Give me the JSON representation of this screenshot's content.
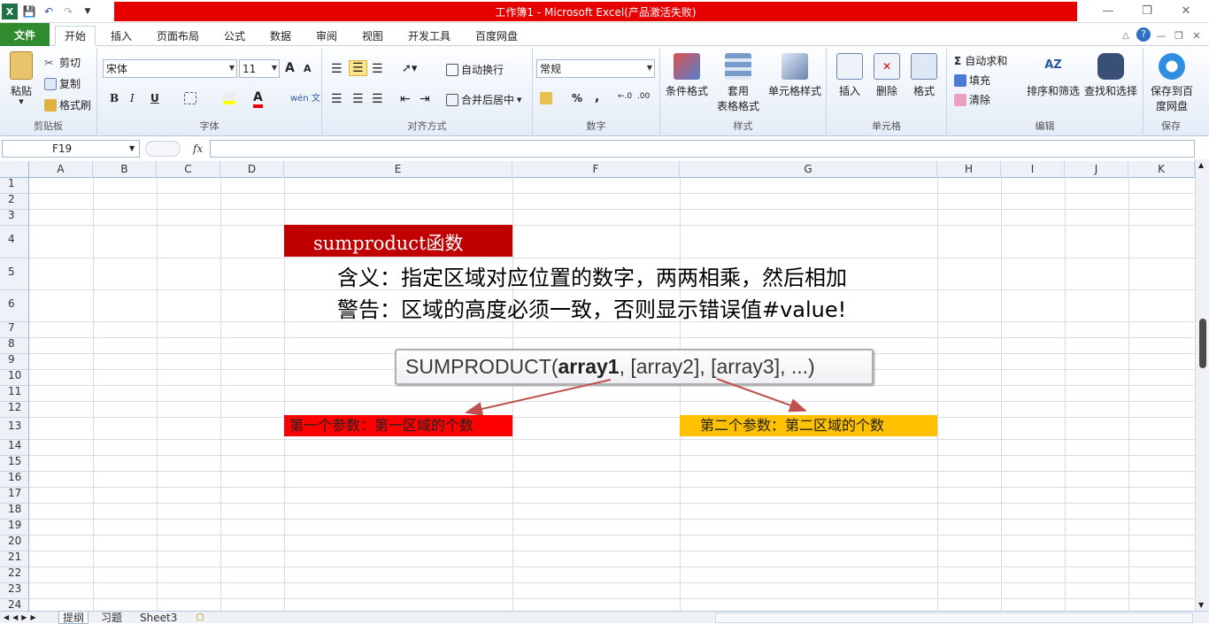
{
  "window": {
    "title": "工作簿1 - Microsoft Excel(产品激活失败)",
    "title_bg": "#e60000"
  },
  "tabs": [
    "文件",
    "开始",
    "插入",
    "页面布局",
    "公式",
    "数据",
    "审阅",
    "视图",
    "开发工具",
    "百度网盘"
  ],
  "ribbon": {
    "clipboard": {
      "label": "剪贴板",
      "paste": "粘贴",
      "cut": "剪切",
      "copy": "复制",
      "format_painter": "格式刷"
    },
    "font": {
      "label": "字体",
      "font_name": "宋体",
      "font_size": "11",
      "bold": "B",
      "italic": "I",
      "underline": "U",
      "grow": "A",
      "shrink": "A",
      "color_a": "A",
      "wen": "wén 文"
    },
    "alignment": {
      "label": "对齐方式",
      "wrap": "自动换行",
      "merge": "合并后居中"
    },
    "number": {
      "label": "数字",
      "format": "常规",
      "percent": "%",
      "comma": ","
    },
    "styles": {
      "label": "样式",
      "conditional": "条件格式",
      "table1": "套用",
      "table2": "表格格式",
      "cell_styles": "单元格样式"
    },
    "cells": {
      "label": "单元格",
      "insert": "插入",
      "delete": "删除",
      "format": "格式"
    },
    "editing": {
      "label": "编辑",
      "autosum": "自动求和",
      "fill": "填充",
      "clear": "清除",
      "sort": "排序和筛选",
      "find": "查找和选择"
    },
    "save": {
      "label": "保存",
      "save1": "保存到百",
      "save2": "度网盘"
    }
  },
  "formula_bar": {
    "name_box": "F19",
    "fx": "fx",
    "value": ""
  },
  "columns": [
    "A",
    "B",
    "C",
    "D",
    "E",
    "F",
    "G",
    "H",
    "I",
    "J",
    "K"
  ],
  "rows": [
    "1",
    "2",
    "3",
    "4",
    "5",
    "6",
    "7",
    "8",
    "9",
    "10",
    "11",
    "12",
    "13",
    "14",
    "15",
    "16",
    "17",
    "18",
    "19",
    "20",
    "21",
    "22",
    "23",
    "24"
  ],
  "content": {
    "title": "sumproduct函数",
    "meaning": "含义：指定区域对应位置的数字，两两相乘，然后相加",
    "warning": "警告：区域的高度必须一致，否则显示错误值#value!",
    "tooltip_prefix": "SUMPRODUCT(",
    "tooltip_bold": "array1",
    "tooltip_suffix": ", [array2], [array3], ...)",
    "param1": "第一个参数：第一区域的个数",
    "param2": "第二个参数：第二区域的个数",
    "param1_bg": "#ff0000",
    "param2_bg": "#ffc000",
    "title_bg": "#c00000"
  },
  "sheets": [
    "提纲",
    "习题",
    "Sheet3"
  ]
}
